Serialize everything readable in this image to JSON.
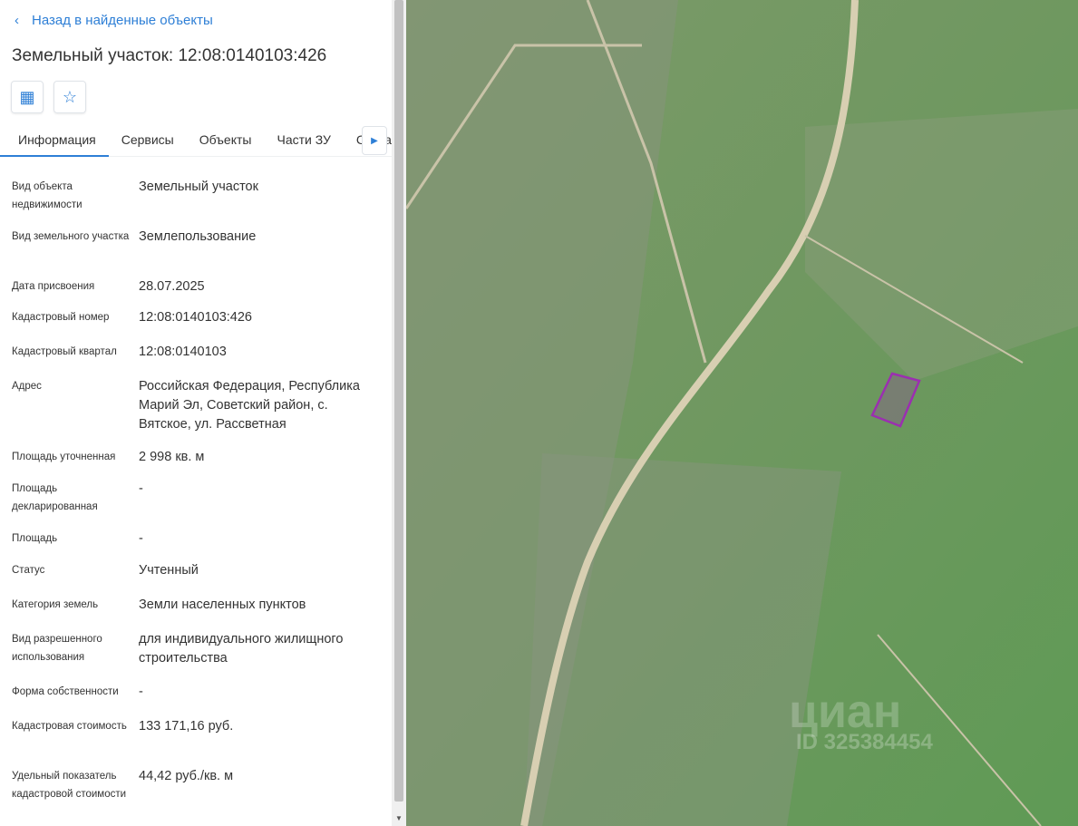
{
  "back_label": "Назад в найденные объекты",
  "title": "Земельный участок: 12:08:0140103:426",
  "tabs": [
    "Информация",
    "Сервисы",
    "Объекты",
    "Части ЗУ",
    "Состав"
  ],
  "fields": [
    {
      "k": "Вид объекта недвижимости",
      "v": "Земельный участок"
    },
    {
      "k": "Вид земельного участка",
      "v": "Землепользование"
    },
    {
      "k": "Дата присвоения",
      "v": "28.07.2025"
    },
    {
      "k": "Кадастровый номер",
      "v": "12:08:0140103:426"
    },
    {
      "k": "Кадастровый квартал",
      "v": "12:08:0140103"
    },
    {
      "k": "Адрес",
      "v": "Российская Федерация, Республика Марий Эл, Советский район, с. Вятское, ул. Рассветная"
    },
    {
      "k": "Площадь уточненная",
      "v": "2 998 кв. м"
    },
    {
      "k": "Площадь декларированная",
      "v": "-"
    },
    {
      "k": "Площадь",
      "v": "-"
    },
    {
      "k": "Статус",
      "v": "Учтенный"
    },
    {
      "k": "Категория земель",
      "v": "Земли населенных пунктов"
    },
    {
      "k": "Вид разрешенного использования",
      "v": "для индивидуального жилищного строительства"
    },
    {
      "k": "Форма собственности",
      "v": "-"
    },
    {
      "k": "Кадастровая стоимость",
      "v": "133 171,16 руб."
    },
    {
      "k": "Удельный показатель кадастровой стоимости",
      "v": "44,42 руб./кв. м"
    }
  ],
  "watermark": {
    "brand": "циан",
    "id": "ID 325384454"
  },
  "colors": {
    "accent": "#2e7fd6",
    "parcel": "#9b2fb0"
  }
}
